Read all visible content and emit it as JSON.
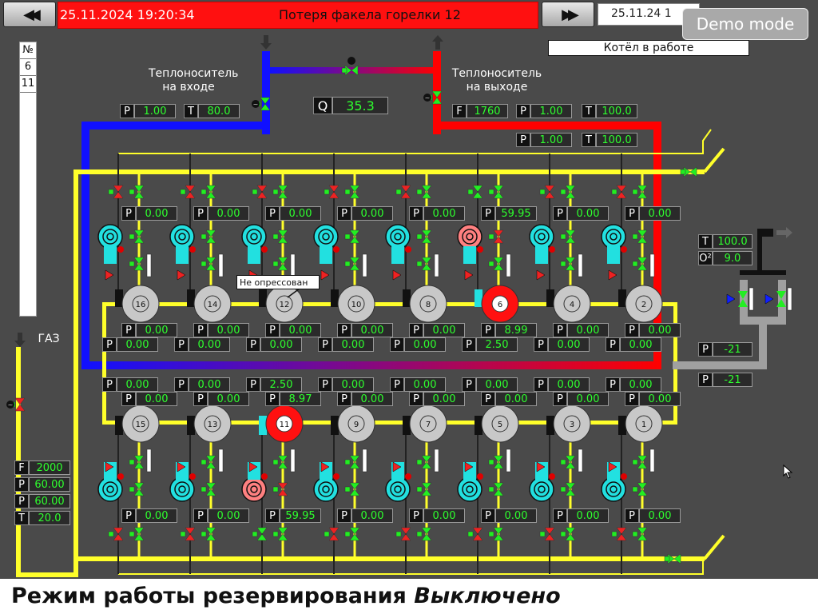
{
  "header": {
    "back_icon": "double-left-arrow",
    "forward_icon": "double-right-arrow",
    "alarm_timestamp": "25.11.2024 19:20:34",
    "alarm_message": "Потеря факела горелки 12",
    "current_date": "25.11.24 1",
    "demo_label": "Demo mode",
    "alarm_color": "#ff1010"
  },
  "boiler_status": "Котёл в работе",
  "number_column": {
    "header": "№",
    "items": [
      "6",
      "11"
    ]
  },
  "coolant": {
    "inlet_label_1": "Теплоноситель",
    "inlet_label_2": "на входе",
    "outlet_label_1": "Теплоноситель",
    "outlet_label_2": "на выходе",
    "inlet_P": "1.00",
    "inlet_T": "80.0",
    "Q_label": "Q",
    "Q": "35.3",
    "outlet_F": "1760",
    "outlet_P": "1.00",
    "outlet_T": "100.0",
    "outlet2_P": "1.00",
    "outlet2_T": "100.0"
  },
  "gas": {
    "label": "ГАЗ",
    "F": "2000",
    "P1": "60.00",
    "P2": "60.00",
    "T": "20.0"
  },
  "flue": {
    "T": "100.0",
    "O2": "9.0",
    "P1": "-21",
    "P2": "-21"
  },
  "tooltip": "Не опрессован",
  "burners_top": [
    {
      "num": "16",
      "p_gas": "0.00",
      "p1": "0.00",
      "p2": "0.00",
      "fault": false
    },
    {
      "num": "14",
      "p_gas": "0.00",
      "p1": "0.00",
      "p2": "0.00",
      "fault": false
    },
    {
      "num": "12",
      "p_gas": "0.00",
      "p1": "0.00",
      "p2": "0.00",
      "fault": false
    },
    {
      "num": "10",
      "p_gas": "0.00",
      "p1": "0.00",
      "p2": "0.00",
      "fault": false
    },
    {
      "num": "8",
      "p_gas": "0.00",
      "p1": "0.00",
      "p2": "0.00",
      "fault": false
    },
    {
      "num": "6",
      "p_gas": "59.95",
      "p1": "8.99",
      "p2": "2.50",
      "fault": true
    },
    {
      "num": "4",
      "p_gas": "0.00",
      "p1": "0.00",
      "p2": "0.00",
      "fault": false
    },
    {
      "num": "2",
      "p_gas": "0.00",
      "p1": "0.00",
      "p2": "0.00",
      "fault": false
    }
  ],
  "burners_bottom": [
    {
      "num": "15",
      "p_gas": "0.00",
      "p1": "0.00",
      "p2": "0.00",
      "fault": false
    },
    {
      "num": "13",
      "p_gas": "0.00",
      "p1": "0.00",
      "p2": "0.00",
      "fault": false
    },
    {
      "num": "11",
      "p_gas": "59.95",
      "p1": "8.97",
      "p2": "2.50",
      "fault": true
    },
    {
      "num": "9",
      "p_gas": "0.00",
      "p1": "0.00",
      "p2": "0.00",
      "fault": false
    },
    {
      "num": "7",
      "p_gas": "0.00",
      "p1": "0.00",
      "p2": "0.00",
      "fault": false
    },
    {
      "num": "5",
      "p_gas": "0.00",
      "p1": "0.00",
      "p2": "0.00",
      "fault": false
    },
    {
      "num": "3",
      "p_gas": "0.00",
      "p1": "0.00",
      "p2": "0.00",
      "fault": false
    },
    {
      "num": "1",
      "p_gas": "0.00",
      "p1": "0.00",
      "p2": "0.00",
      "fault": false
    }
  ],
  "footer": {
    "label": "Режим работы резервирования",
    "value": "Выключено"
  },
  "keys": {
    "P": "P",
    "T": "T",
    "F": "F",
    "O2": "O²"
  },
  "colors": {
    "gas_pipe": "#ffff2a",
    "hot_pipe": "#ff0000",
    "cold_pipe": "#1010ff",
    "valve_open": "#22ee22",
    "valve_closed": "#ee2222",
    "fan": "#22e0e0",
    "flue_pipe": "#a0a0a0"
  }
}
